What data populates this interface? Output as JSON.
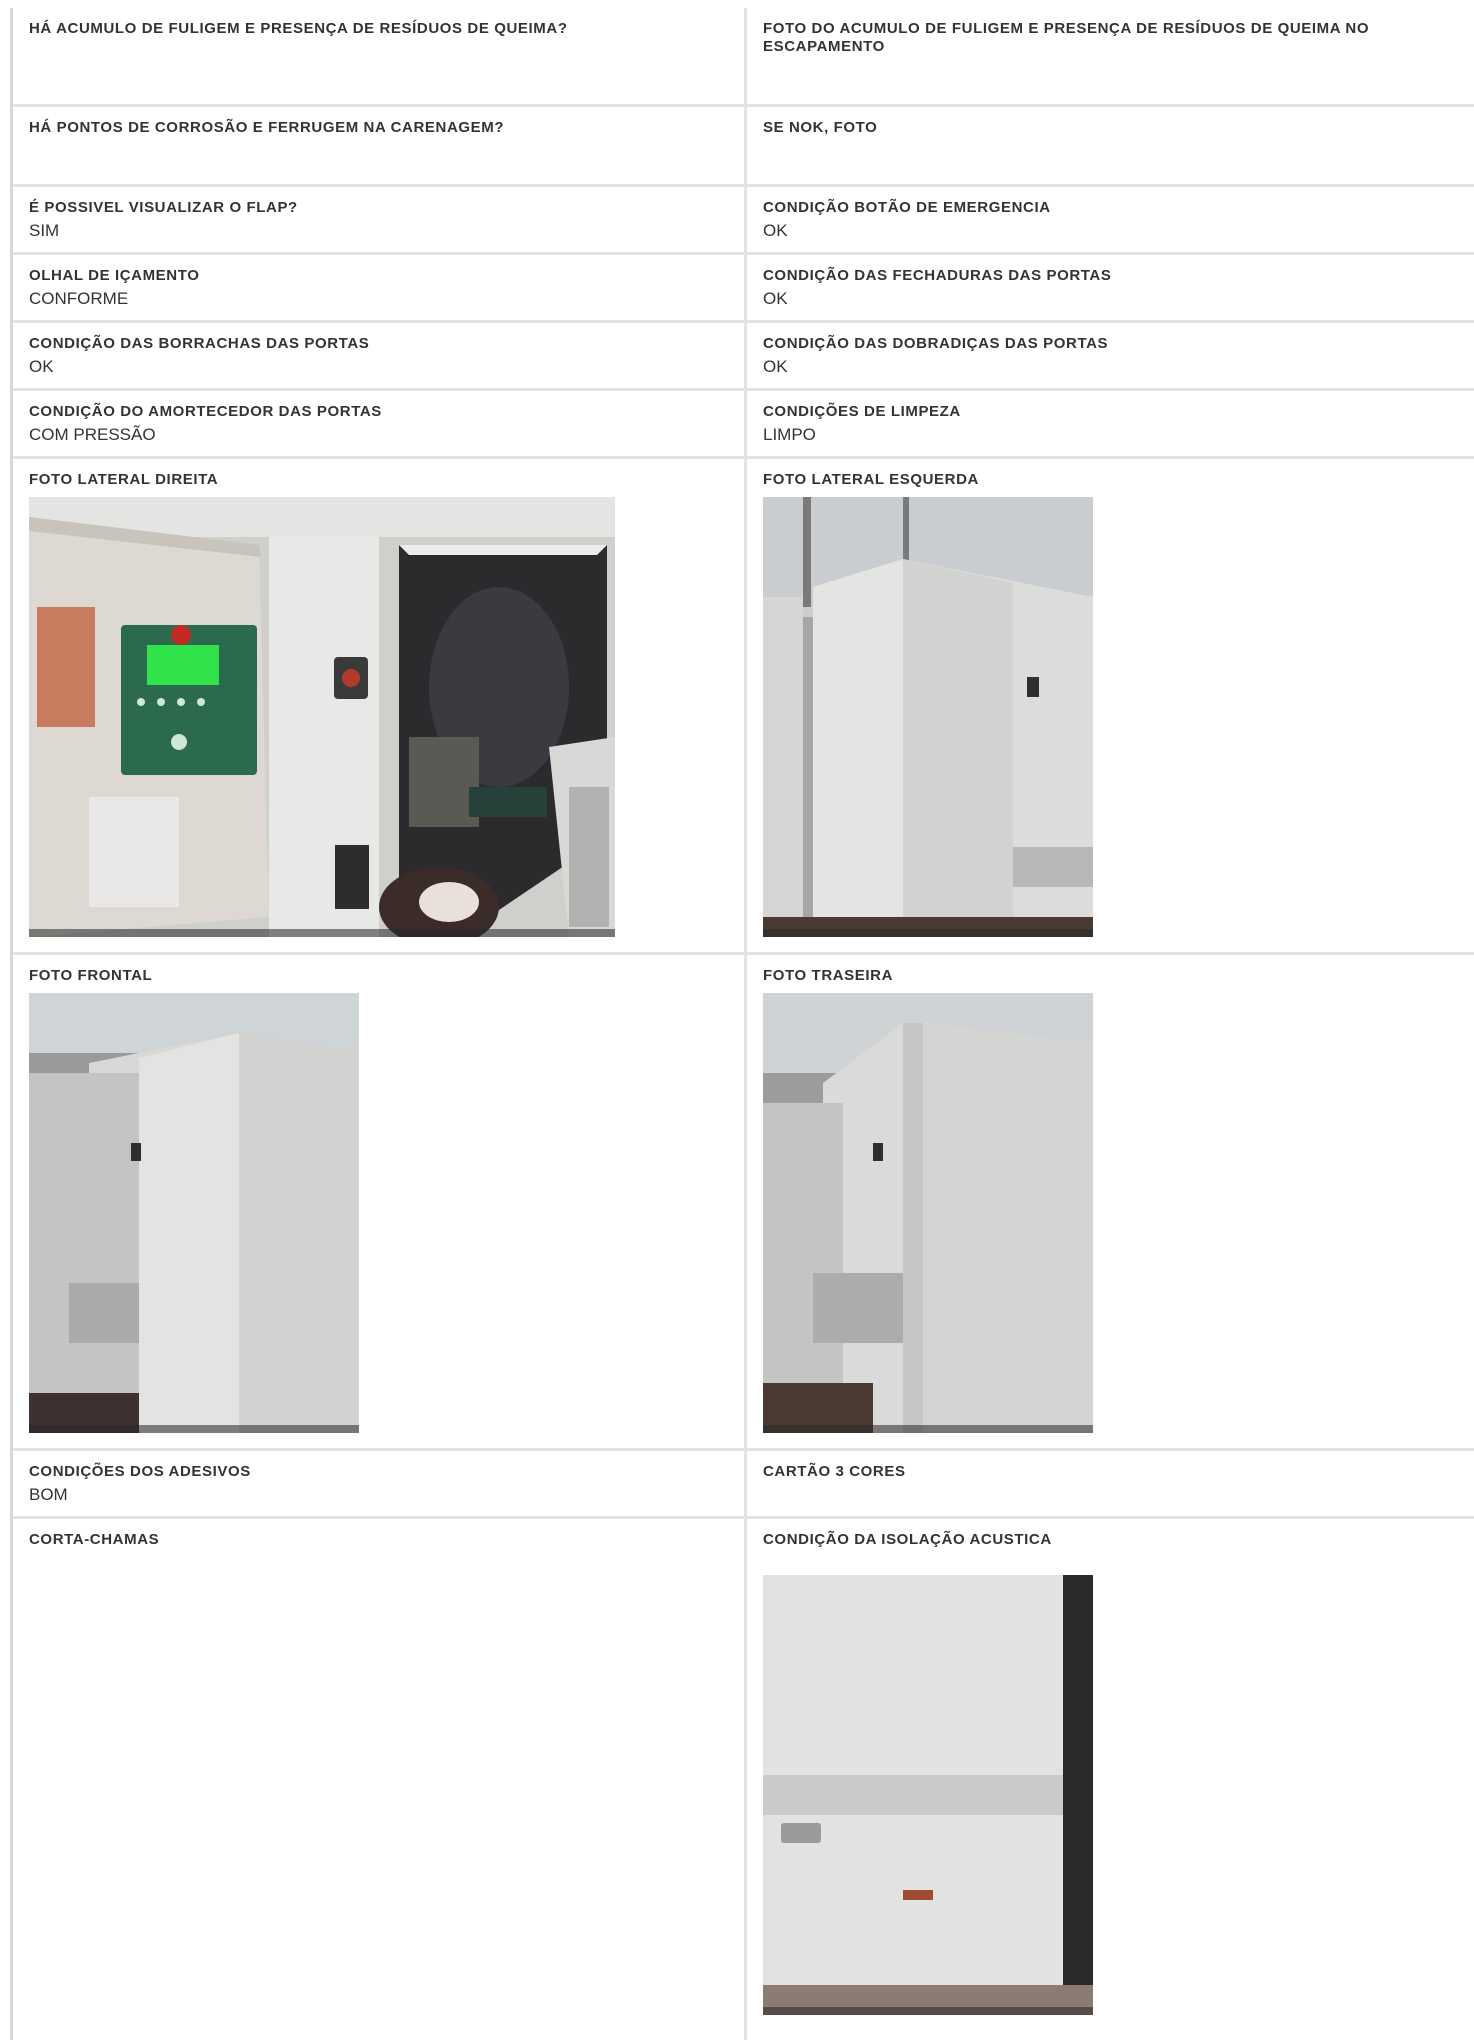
{
  "rows": [
    {
      "left": {
        "label": "HÁ ACUMULO DE FULIGEM E PRESENÇA DE RESÍDUOS DE QUEIMA?",
        "value": ""
      },
      "right": {
        "label": "FOTO DO ACUMULO DE FULIGEM E PRESENÇA DE RESÍDUOS DE QUEIMA NO ESCAPAMENTO",
        "value": ""
      }
    },
    {
      "left": {
        "label": "HÁ PONTOS DE CORROSÃO E FERRUGEM NA CARENAGEM?",
        "value": ""
      },
      "right": {
        "label": "SE NOK, FOTO",
        "value": ""
      }
    },
    {
      "left": {
        "label": "É POSSIVEL VISUALIZAR O FLAP?",
        "value": "SIM"
      },
      "right": {
        "label": "CONDIÇÃO BOTÃO DE EMERGENCIA",
        "value": "OK"
      }
    },
    {
      "left": {
        "label": "OLHAL DE IÇAMENTO",
        "value": "CONFORME"
      },
      "right": {
        "label": "CONDIÇÃO DAS FECHADURAS DAS PORTAS",
        "value": "OK"
      }
    },
    {
      "left": {
        "label": "CONDIÇÃO DAS BORRACHAS DAS PORTAS",
        "value": "OK"
      },
      "right": {
        "label": "CONDIÇÃO DAS DOBRADIÇAS DAS PORTAS",
        "value": "OK"
      }
    },
    {
      "left": {
        "label": "CONDIÇÃO DO AMORTECEDOR DAS PORTAS",
        "value": "COM PRESSÃO"
      },
      "right": {
        "label": "CONDIÇÕES DE LIMPEZA",
        "value": "LIMPO"
      }
    },
    {
      "left": {
        "label": "FOTO LATERAL DIREITA"
      },
      "right": {
        "label": "FOTO LATERAL ESQUERDA"
      }
    },
    {
      "left": {
        "label": "FOTO FRONTAL"
      },
      "right": {
        "label": "FOTO TRASEIRA"
      }
    },
    {
      "left": {
        "label": "CONDIÇÕES DOS ADESIVOS",
        "value": "BOM"
      },
      "right": {
        "label": "CARTÃO 3 CORES",
        "value": ""
      }
    },
    {
      "left": {
        "label": "CORTA-CHAMAS",
        "value": ""
      },
      "right": {
        "label": "CONDIÇÃO DA ISOLAÇÃO ACUSTICA",
        "value": ""
      }
    }
  ]
}
